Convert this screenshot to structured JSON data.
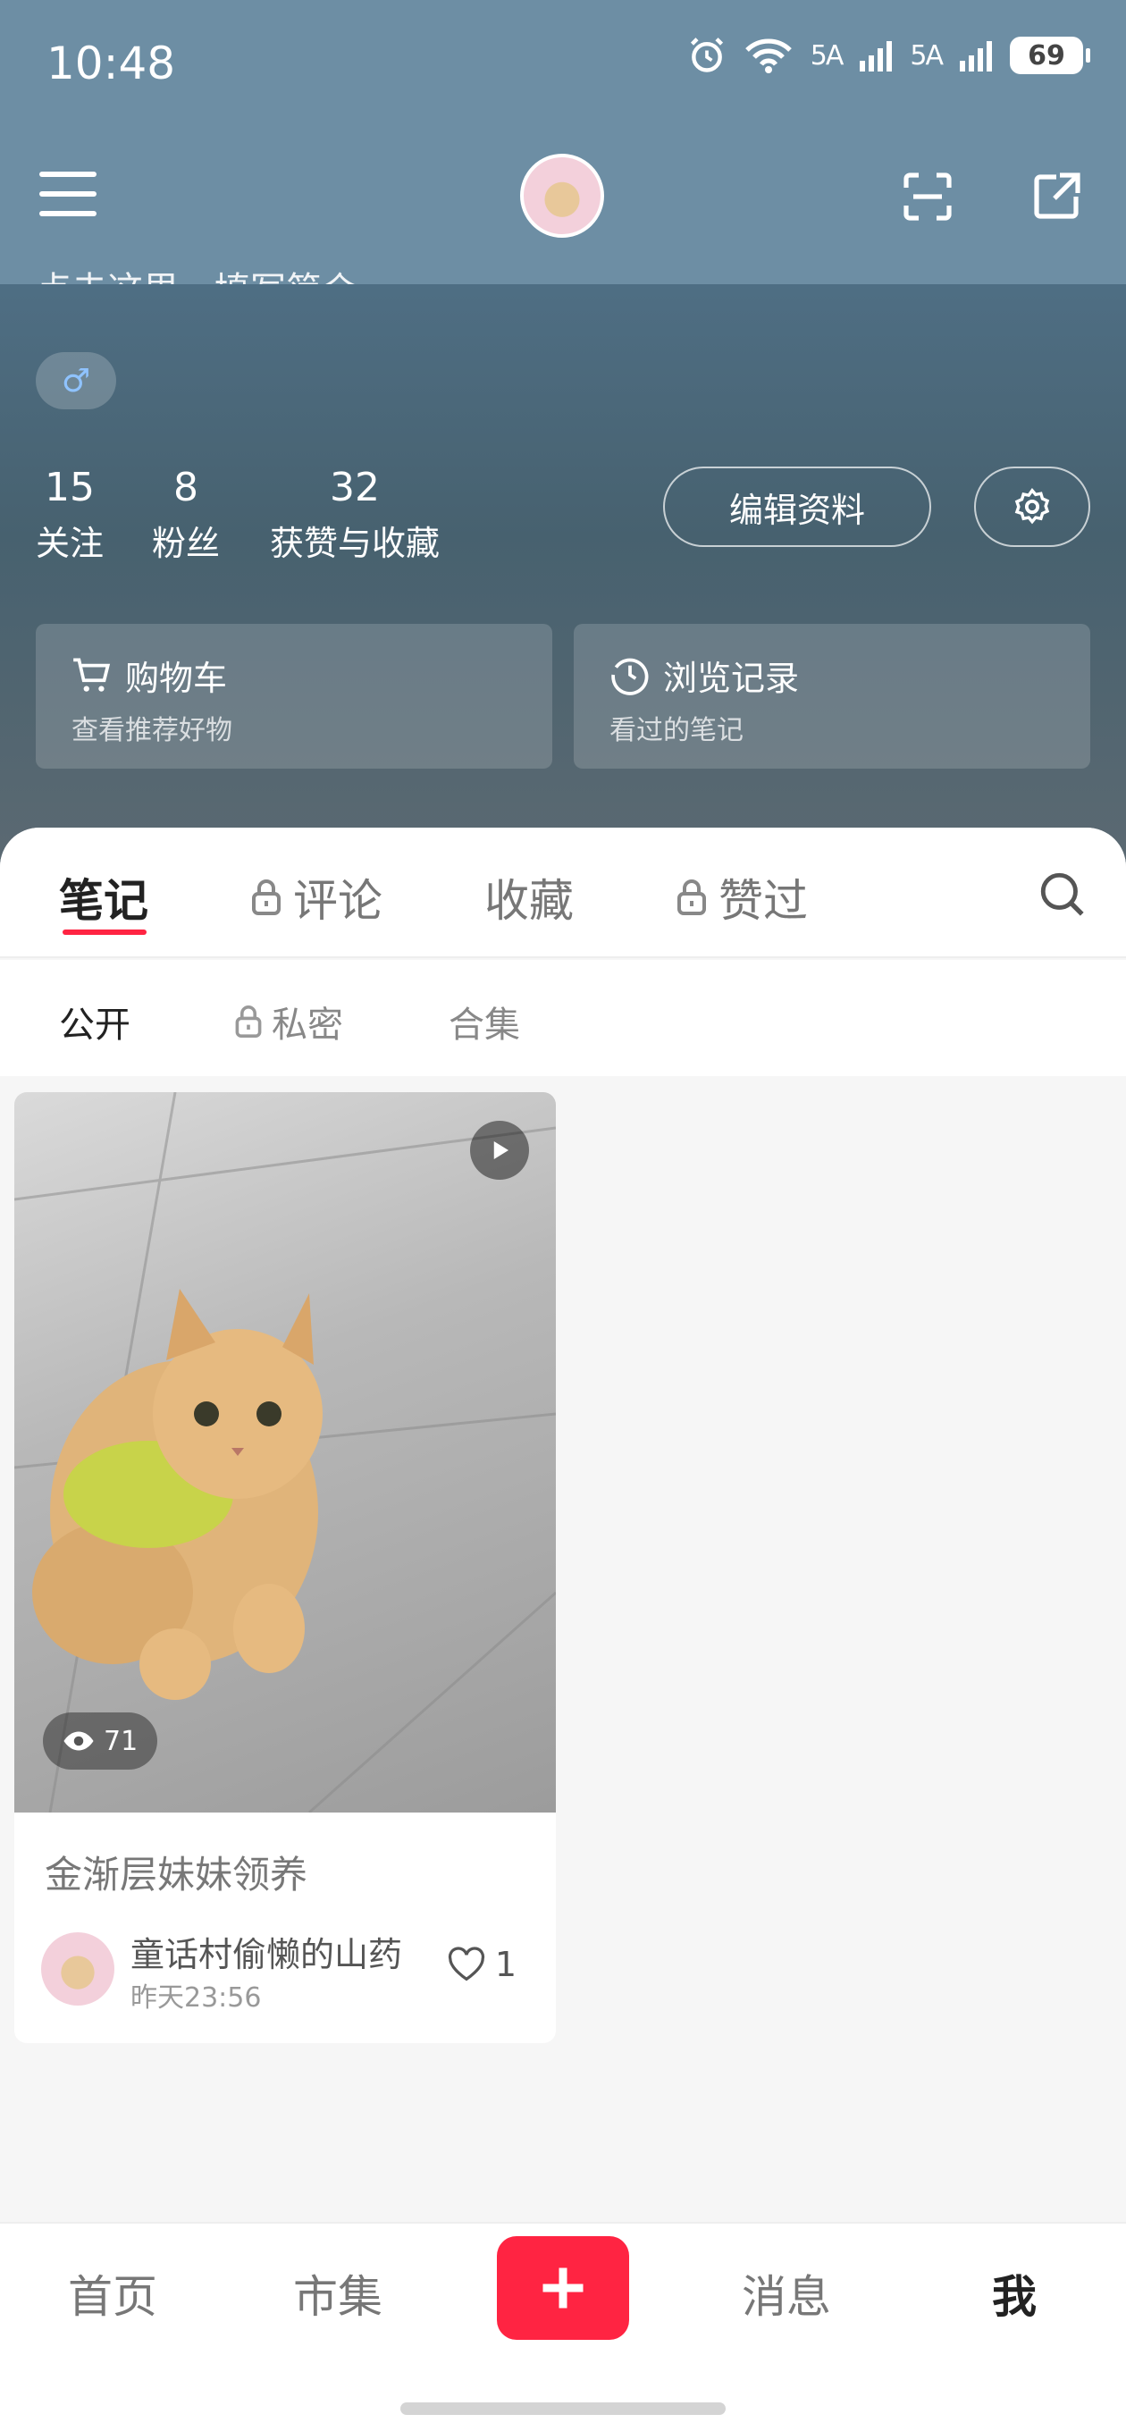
{
  "status_bar": {
    "time": "10:48",
    "signal1": "5A",
    "signal2": "5A",
    "battery": "69"
  },
  "header": {
    "bio_placeholder": "点击这里，填写简介"
  },
  "profile": {
    "gender_symbol": "♂",
    "stats": [
      {
        "num": "15",
        "label": "关注"
      },
      {
        "num": "8",
        "label": "粉丝"
      },
      {
        "num": "32",
        "label": "获赞与收藏"
      }
    ],
    "edit_label": "编辑资料"
  },
  "cards": [
    {
      "title": "购物车",
      "subtitle": "查看推荐好物"
    },
    {
      "title": "浏览记录",
      "subtitle": "看过的笔记"
    }
  ],
  "tabs": [
    {
      "label": "笔记",
      "locked": false
    },
    {
      "label": "评论",
      "locked": true
    },
    {
      "label": "收藏",
      "locked": false
    },
    {
      "label": "赞过",
      "locked": true
    }
  ],
  "subtabs": [
    {
      "label": "公开",
      "locked": false
    },
    {
      "label": "私密",
      "locked": true
    },
    {
      "label": "合集",
      "locked": false
    }
  ],
  "note": {
    "views": "71",
    "title": "金渐层妹妹领养",
    "author": "童话村偷懒的山药",
    "time": "昨天23:56",
    "likes": "1"
  },
  "bottom_nav": {
    "home": "首页",
    "market": "市集",
    "messages": "消息",
    "me": "我"
  },
  "colors": {
    "accent": "#ff2442",
    "header": "#6d8ea4"
  }
}
